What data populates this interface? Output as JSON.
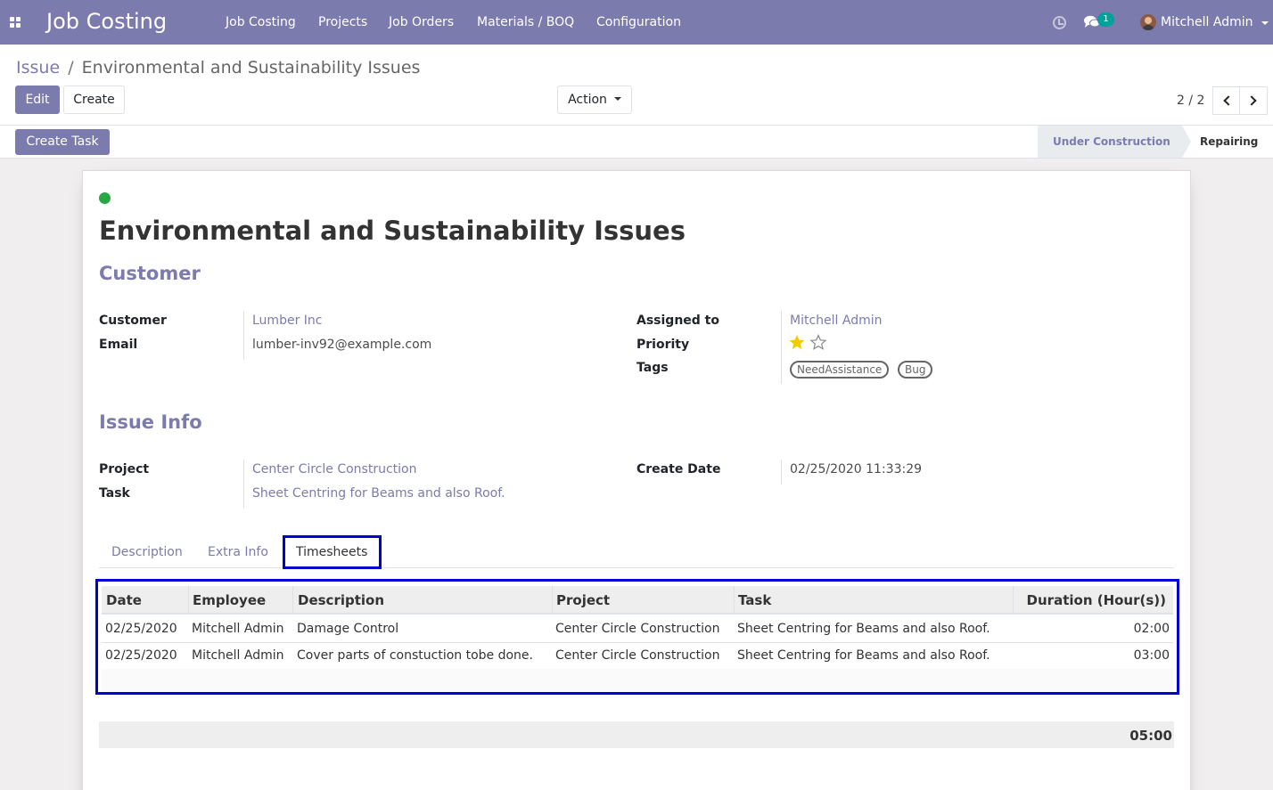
{
  "navbar": {
    "app_name": "Job Costing",
    "menu": [
      "Job Costing",
      "Projects",
      "Job Orders",
      "Materials / BOQ",
      "Configuration"
    ],
    "chat_count": "1",
    "user_name": "Mitchell Admin",
    "color": "#7c7bad"
  },
  "breadcrumb": {
    "parent": "Issue",
    "separator": "/",
    "current": "Environmental and Sustainability Issues"
  },
  "toolbar": {
    "edit_label": "Edit",
    "create_label": "Create",
    "action_label": "Action",
    "pager": "2 / 2"
  },
  "statusbar": {
    "create_task_label": "Create Task",
    "stages": [
      "Under Construction",
      "Repairing"
    ]
  },
  "record": {
    "title": "Environmental and Sustainability Issues",
    "status_color": "#28a745",
    "customer_section": {
      "heading": "Customer",
      "customer_label": "Customer",
      "customer_value": "Lumber Inc",
      "email_label": "Email",
      "email_value": "lumber-inv92@example.com",
      "assigned_label": "Assigned to",
      "assigned_value": "Mitchell Admin",
      "priority_label": "Priority",
      "priority_stars": 1,
      "priority_max": 2,
      "tags_label": "Tags",
      "tags": [
        "NeedAssistance",
        "Bug"
      ]
    },
    "issue_section": {
      "heading": "Issue Info",
      "project_label": "Project",
      "project_value": "Center Circle Construction",
      "task_label": "Task",
      "task_value": "Sheet Centring for Beams and also Roof.",
      "create_date_label": "Create Date",
      "create_date_value": "02/25/2020 11:33:29"
    }
  },
  "tabs": [
    "Description",
    "Extra Info",
    "Timesheets"
  ],
  "active_tab": "Timesheets",
  "timesheet": {
    "columns": [
      "Date",
      "Employee",
      "Description",
      "Project",
      "Task",
      "Duration (Hour(s))"
    ],
    "rows": [
      {
        "date": "02/25/2020",
        "employee": "Mitchell Admin",
        "description": "Damage Control",
        "project": "Center Circle Construction",
        "task": "Sheet Centring for Beams and also Roof.",
        "duration": "02:00"
      },
      {
        "date": "02/25/2020",
        "employee": "Mitchell Admin",
        "description": "Cover parts of constuction tobe done.",
        "project": "Center Circle Construction",
        "task": "Sheet Centring for Beams and also Roof.",
        "duration": "03:00"
      }
    ],
    "total": "05:00"
  }
}
